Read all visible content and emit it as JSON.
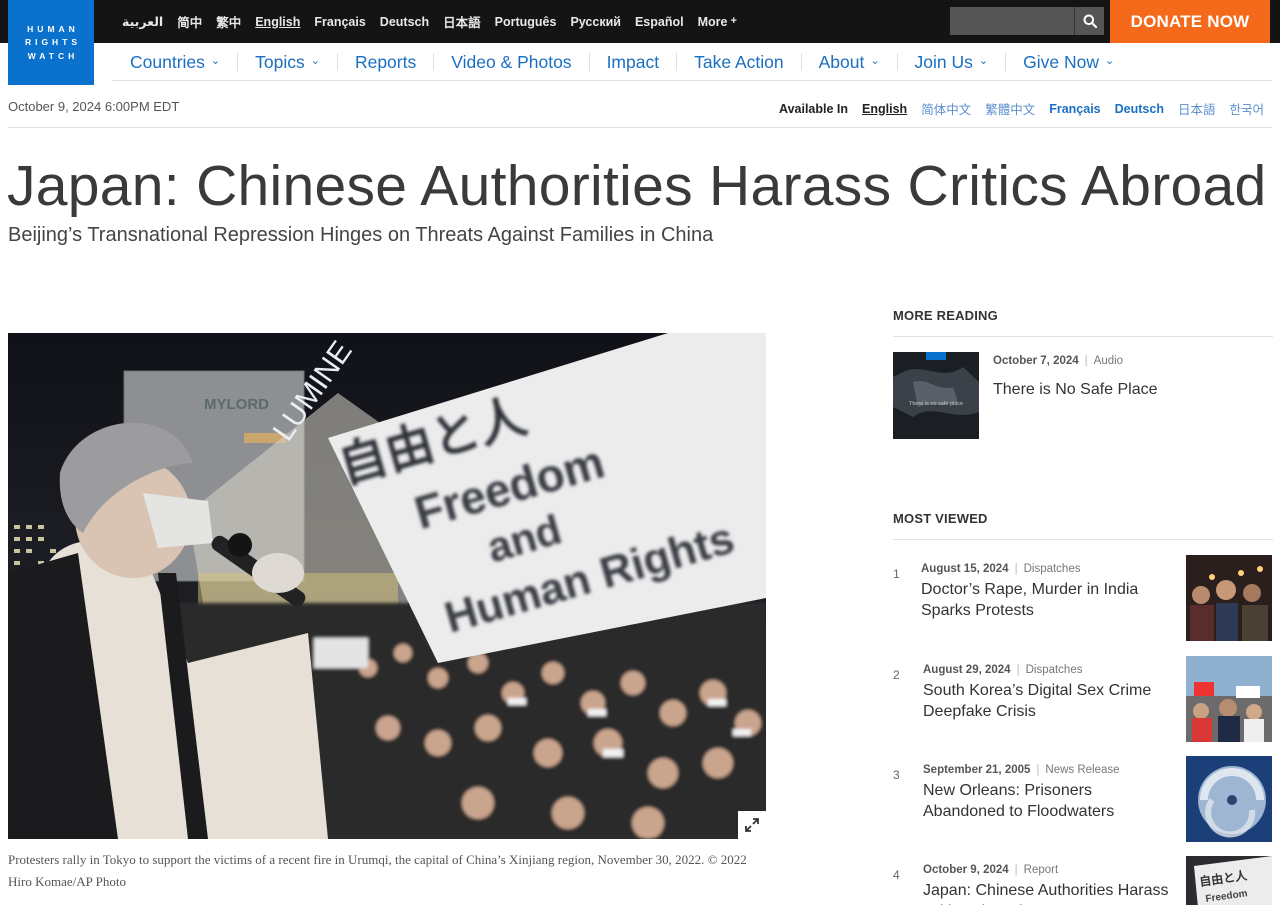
{
  "logo": {
    "lines": [
      "HUMAN",
      "RIGHTS",
      "WATCH"
    ]
  },
  "languages": [
    {
      "label": "العربية",
      "active": false
    },
    {
      "label": "简中",
      "active": false
    },
    {
      "label": "繁中",
      "active": false
    },
    {
      "label": "English",
      "active": true
    },
    {
      "label": "Français",
      "active": false
    },
    {
      "label": "Deutsch",
      "active": false
    },
    {
      "label": "日本語",
      "active": false
    },
    {
      "label": "Português",
      "active": false
    },
    {
      "label": "Русский",
      "active": false
    },
    {
      "label": "Español",
      "active": false
    },
    {
      "label": "More",
      "active": false
    }
  ],
  "search": {
    "placeholder": ""
  },
  "donate_label": "DONATE NOW",
  "nav": [
    {
      "label": "Countries",
      "dropdown": true
    },
    {
      "label": "Topics",
      "dropdown": true
    },
    {
      "label": "Reports",
      "dropdown": false
    },
    {
      "label": "Video & Photos",
      "dropdown": false
    },
    {
      "label": "Impact",
      "dropdown": false
    },
    {
      "label": "Take Action",
      "dropdown": false
    },
    {
      "label": "About",
      "dropdown": true
    },
    {
      "label": "Join Us",
      "dropdown": true
    },
    {
      "label": "Give Now",
      "dropdown": true
    }
  ],
  "article": {
    "date": "October 9, 2024 6:00PM EDT",
    "available_in_label": "Available In",
    "available_languages": [
      {
        "label": "English",
        "active": true,
        "cjk": false
      },
      {
        "label": "简体中文",
        "active": false,
        "cjk": true
      },
      {
        "label": "繁體中文",
        "active": false,
        "cjk": true
      },
      {
        "label": "Français",
        "active": false,
        "cjk": false
      },
      {
        "label": "Deutsch",
        "active": false,
        "cjk": false
      },
      {
        "label": "日本語",
        "active": false,
        "cjk": true
      },
      {
        "label": "한국어",
        "active": false,
        "cjk": true
      }
    ],
    "title": "Japan: Chinese Authorities Harass Critics Abroad",
    "subtitle": "Beijing’s Transnational Repression Hinges on Threats Against Families in China",
    "photo": {
      "sign_lines": [
        "自由と人",
        "Freedom",
        "and",
        "Human Rights"
      ],
      "building_sign": "MYLORD",
      "building_sign_2": "LUMINE"
    },
    "caption": "Protesters rally in Tokyo to support the victims of a recent fire in Urumqi, the capital of China’s Xinjiang region, November 30, 2022. © 2022 Hiro Komae/AP Photo"
  },
  "sidebar": {
    "more_reading": {
      "heading": "MORE READING",
      "item": {
        "date": "October 7, 2024",
        "type": "Audio",
        "title": "There is No Safe Place",
        "thumb_text": "There is no safe place"
      }
    },
    "most_viewed": {
      "heading": "MOST VIEWED",
      "items": [
        {
          "num": "1",
          "date": "August 15, 2024",
          "type": "Dispatches",
          "title": "Doctor’s Rape, Murder in India Sparks Protests"
        },
        {
          "num": "2",
          "date": "August 29, 2024",
          "type": "Dispatches",
          "title": "South Korea’s Digital Sex Crime Deepfake Crisis"
        },
        {
          "num": "3",
          "date": "September 21, 2005",
          "type": "News Release",
          "title": "New Orleans: Prisoners Abandoned to Floodwaters"
        },
        {
          "num": "4",
          "date": "October 9, 2024",
          "type": "Report",
          "title": "Japan: Chinese Authorities Harass Critics Abroad"
        }
      ]
    }
  }
}
